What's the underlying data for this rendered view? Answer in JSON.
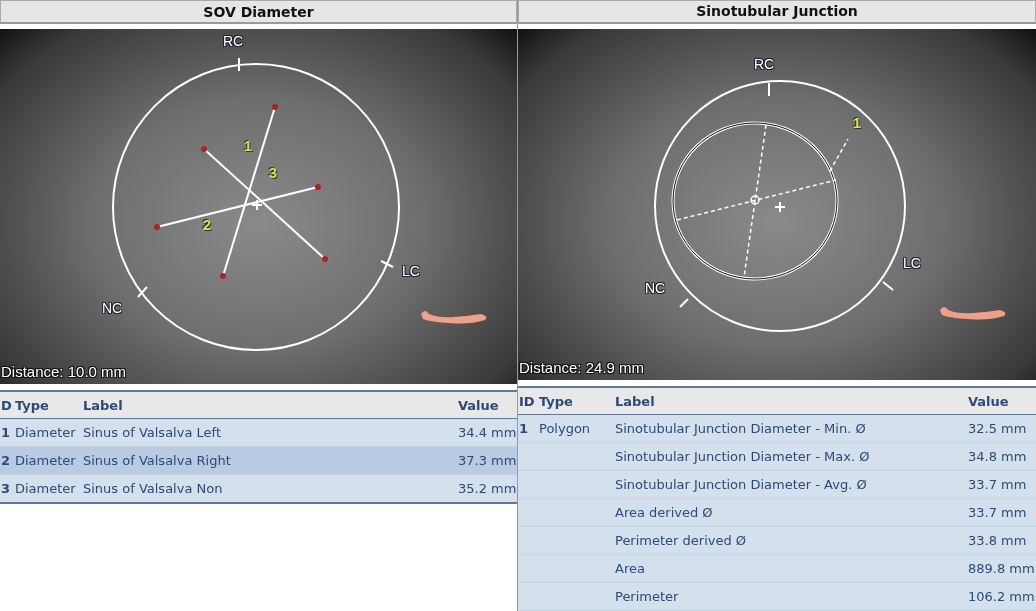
{
  "panels": [
    {
      "title": "SOV Diameter",
      "kind": "diameters",
      "viewer": {
        "cusp_labels": [
          "RC",
          "LC",
          "NC"
        ],
        "marker_numbers": [
          "1",
          "2",
          "3"
        ],
        "distance": "Distance: 10.0 mm"
      },
      "table": {
        "columns": [
          "D",
          "Type",
          "Label",
          "Value"
        ],
        "rows": [
          {
            "id": "1",
            "type": "Diameter",
            "label": "Sinus of Valsalva Left",
            "value": "34.4 mm",
            "selected": false
          },
          {
            "id": "2",
            "type": "Diameter",
            "label": "Sinus of Valsalva Right",
            "value": "37.3 mm",
            "selected": true
          },
          {
            "id": "3",
            "type": "Diameter",
            "label": "Sinus of Valsalva Non",
            "value": "35.2 mm",
            "selected": false
          }
        ]
      }
    },
    {
      "title": "Sinotubular Junction",
      "kind": "polygon",
      "viewer": {
        "cusp_labels": [
          "RC",
          "LC",
          "NC"
        ],
        "marker_numbers": [
          "1"
        ],
        "distance": "Distance: 24.9 mm"
      },
      "table": {
        "columns": [
          "ID",
          "Type",
          "Label",
          "Value"
        ],
        "rows": [
          {
            "id": "1",
            "type": "Polygon",
            "label": "Sinotubular Junction Diameter - Min. Ø",
            "value": "32.5 mm",
            "selected": false
          },
          {
            "label": "Sinotubular Junction Diameter - Max. Ø",
            "value": "34.8 mm",
            "selected": false
          },
          {
            "label": "Sinotubular Junction Diameter - Avg. Ø",
            "value": "33.7 mm",
            "selected": false
          },
          {
            "label": "Area derived Ø",
            "value": "33.7 mm",
            "selected": false
          },
          {
            "label": "Perimeter derived Ø",
            "value": "33.8 mm",
            "selected": false
          },
          {
            "label": "Area",
            "value": "889.8 mm",
            "selected": false
          },
          {
            "label": "Perimeter",
            "value": "106.2 mm",
            "selected": false
          }
        ]
      }
    }
  ]
}
